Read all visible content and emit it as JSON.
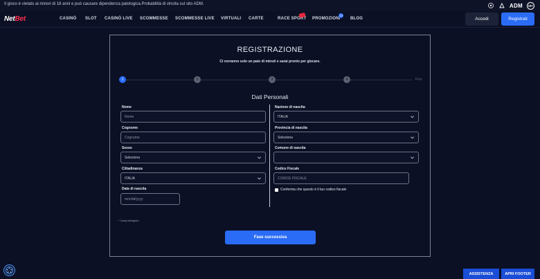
{
  "top_bar": {
    "warning": "Il gioco è vietato ai minori di 18 anni e può causare dipendenza patologica.Probabilità di vincita sul sito ADM.",
    "adm_label": "ADM",
    "age_label": "18+"
  },
  "logo": {
    "part1": "Net",
    "part2": "Bet"
  },
  "nav": {
    "items": [
      "CASINÒ",
      "SLOT",
      "CASINÒ LIVE",
      "SCOMMESSE",
      "SCOMMESSE LIVE",
      "VIRTUALI",
      "CARTE",
      "RACE SPORT",
      "PROMOZIONI",
      "BLOG"
    ],
    "promo_count": "13",
    "login_label": "Accedi",
    "register_label": "Registrati"
  },
  "form": {
    "title": "REGISTRAZIONE",
    "subtitle": "Ci vorranno solo un paio di minuti e sarai pronto per giocare.",
    "steps": [
      "1",
      "2",
      "3",
      "4"
    ],
    "steps_end": "Fine",
    "section_title": "Dati Personali",
    "left": {
      "nome_label": "Nome",
      "nome_placeholder": "Nome",
      "cognome_label": "Cognome",
      "cognome_placeholder": "Cognome",
      "sesso_label": "Sesso",
      "sesso_value": "Seleziona",
      "cittadinanza_label": "Cittadinanza",
      "cittadinanza_value": "ITALIA",
      "data_label": "Data di nascita",
      "data_placeholder": "mm/dd/yyyy"
    },
    "right": {
      "nazione_label": "Nazione di nascita",
      "nazione_value": "ITALIA",
      "provincia_label": "Provincia di nascita",
      "provincia_value": "Seleziona",
      "comune_label": "Comune di nascita",
      "comune_value": "",
      "codice_label": "Codice Fiscale",
      "codice_placeholder": "CODICE FISCALE",
      "confirm_label": "Conferma che questo è il tuo codice fiscale"
    },
    "required_note": "* Campi obbligatori",
    "next_label": "Fase successiva"
  },
  "footer": {
    "assist_label": "ASSISTENZA",
    "footer_label": "APRI FOOTER"
  }
}
